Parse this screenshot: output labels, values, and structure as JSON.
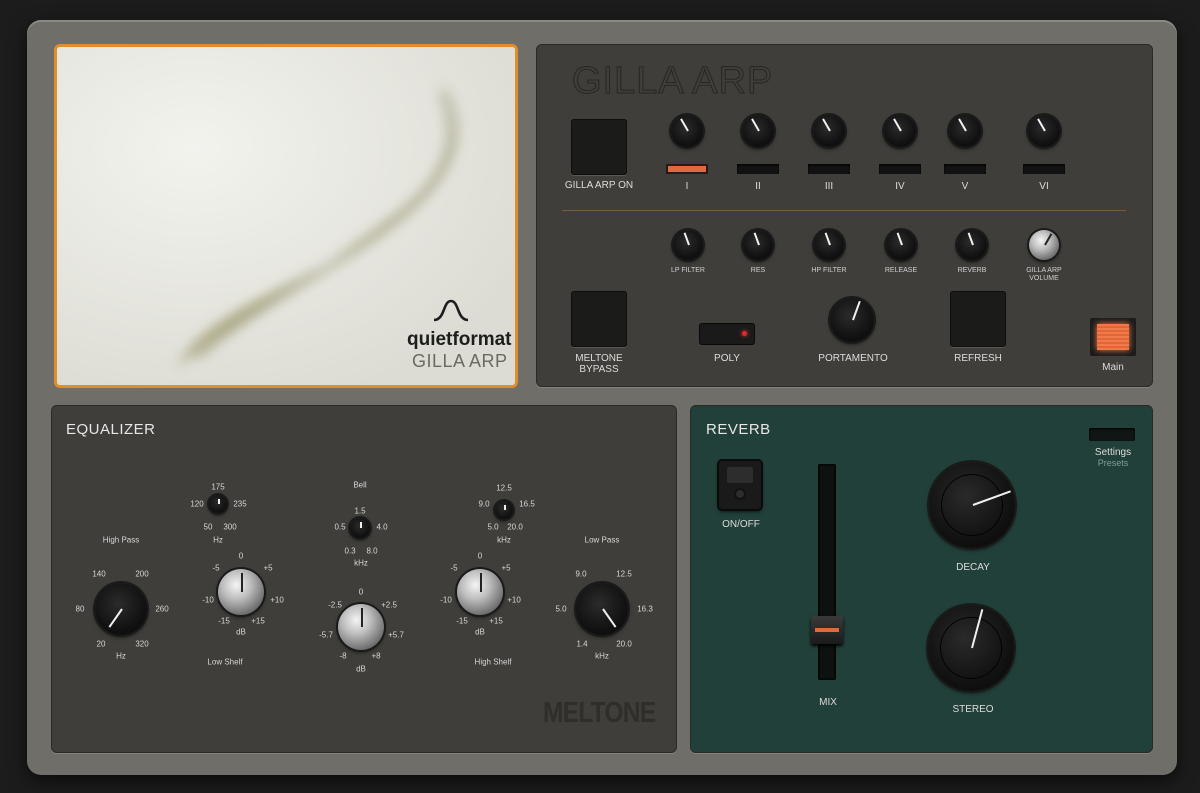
{
  "brand": {
    "company": "quietformat",
    "product": "GILLA ARP"
  },
  "arp": {
    "title": "GILLA ARP",
    "on_label": "GILLA ARP ON",
    "steps": [
      {
        "label": "I",
        "active": true
      },
      {
        "label": "II",
        "active": false
      },
      {
        "label": "III",
        "active": false
      },
      {
        "label": "IV",
        "active": false
      },
      {
        "label": "V",
        "active": false
      },
      {
        "label": "VI",
        "active": false
      }
    ],
    "knobs": [
      "LP FILTER",
      "RES",
      "HP FILTER",
      "RELEASE",
      "REVERB",
      "GILLA ARP VOLUME"
    ],
    "meltone_bypass": "MELTONE BYPASS",
    "poly": "POLY",
    "portamento": "PORTAMENTO",
    "refresh": "REFRESH",
    "main": "Main"
  },
  "equalizer": {
    "title": "EQUALIZER",
    "brand": "MELTONE",
    "high_pass": {
      "label": "High Pass",
      "ticks": [
        "140",
        "200",
        "80",
        "260",
        "20",
        "320"
      ],
      "unit": "Hz"
    },
    "low_shelf_freq": {
      "ticks": [
        "175",
        "120",
        "235",
        "50",
        "300"
      ],
      "unit": "Hz"
    },
    "low_shelf_gain": {
      "label": "Low Shelf",
      "ticks": [
        "0",
        "-5",
        "+5",
        "-10",
        "+10",
        "-15",
        "+15"
      ],
      "unit": "dB"
    },
    "bell_freq": {
      "label": "Bell",
      "ticks": [
        "1.5",
        "0.5",
        "4.0",
        "0.3",
        "8.0"
      ],
      "unit": "kHz"
    },
    "bell_gain": {
      "ticks": [
        "0",
        "-2.5",
        "+2.5",
        "-5.7",
        "+5.7",
        "-8",
        "+8"
      ],
      "unit": "dB"
    },
    "high_shelf_freq": {
      "ticks": [
        "12.5",
        "9.0",
        "16.5",
        "5.0",
        "20.0"
      ],
      "unit": "kHz"
    },
    "high_shelf_gain": {
      "label": "High Shelf",
      "ticks": [
        "0",
        "-5",
        "+5",
        "-10",
        "+10",
        "-15",
        "+15"
      ],
      "unit": "dB"
    },
    "low_pass": {
      "label": "Low Pass",
      "ticks": [
        "9.0",
        "12.5",
        "5.0",
        "16.3",
        "1.4",
        "20.0"
      ],
      "unit": "kHz"
    }
  },
  "reverb": {
    "title": "REVERB",
    "settings": "Settings",
    "presets": "Presets",
    "on_off": "ON/OFF",
    "mix": "MIX",
    "mix_level": 0.12,
    "decay": "DECAY",
    "stereo": "STEREO"
  },
  "colors": {
    "accent": "#e08d2e",
    "step_active": "#e06a3d",
    "reverb_panel": "#22403a",
    "panel": "#3f3e3a"
  }
}
